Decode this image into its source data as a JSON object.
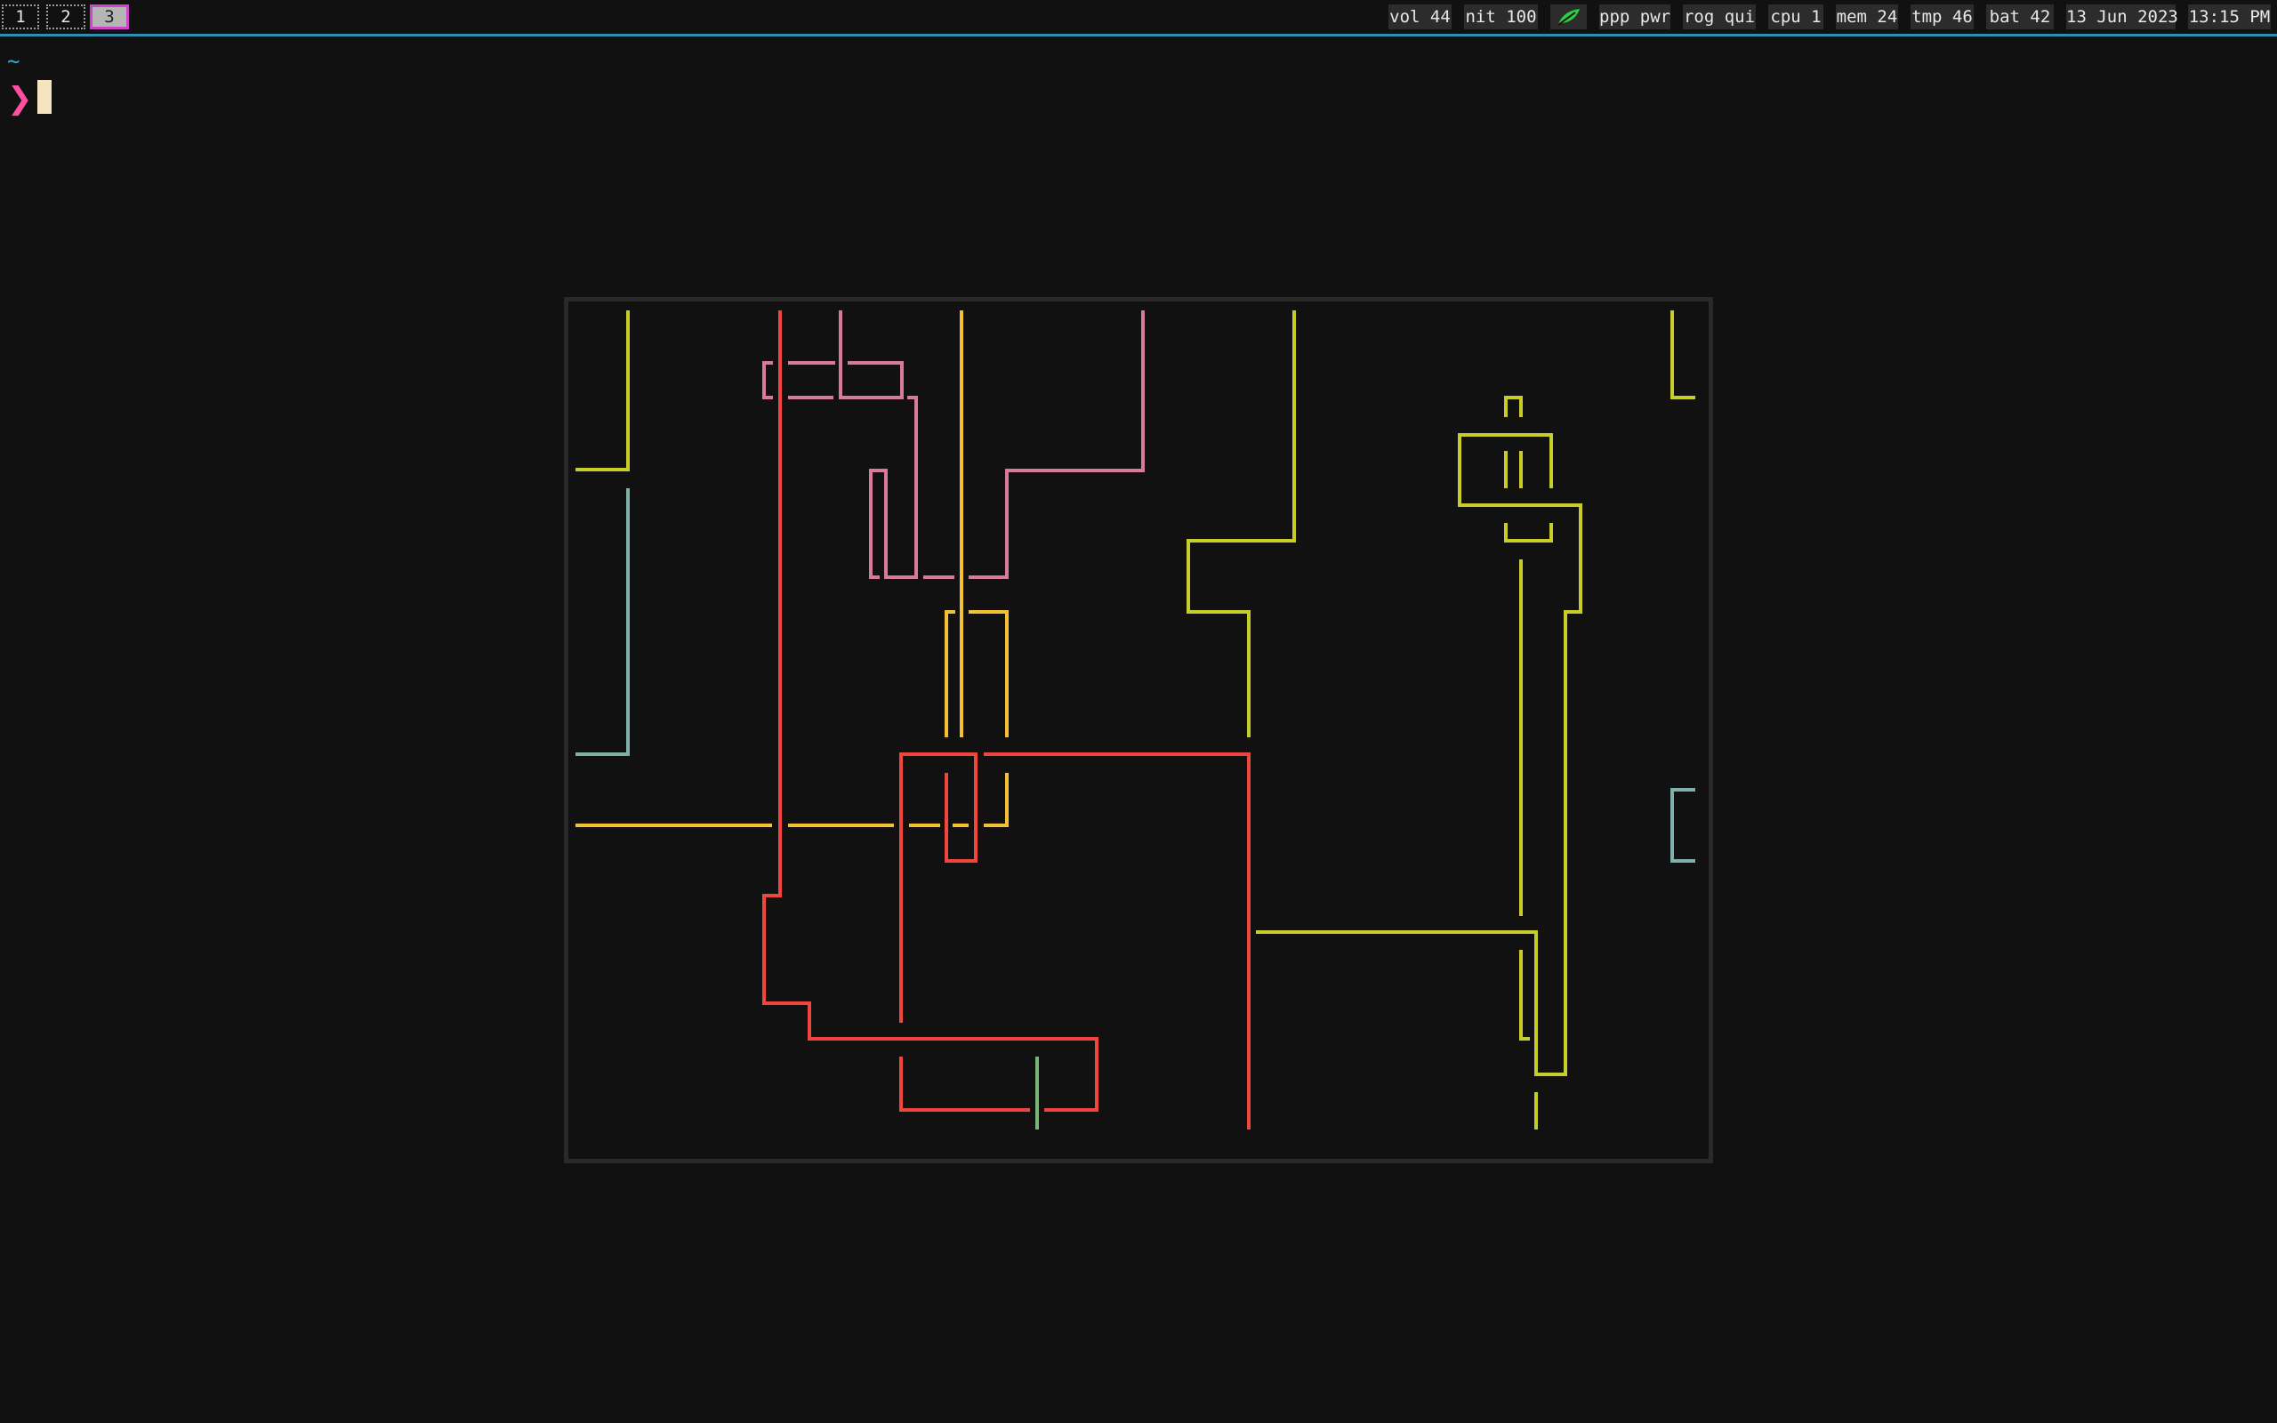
{
  "workspaces": [
    {
      "label": "1",
      "active": false
    },
    {
      "label": "2",
      "active": false
    },
    {
      "label": "3",
      "active": true
    }
  ],
  "status": {
    "vol": "vol 44",
    "nit": "nit 100",
    "ppp": "ppp pwr",
    "rog": "rog qui",
    "cpu": "cpu 1",
    "mem": "mem 24",
    "tmp": "tmp 46",
    "bat": "bat 42",
    "date": "13 Jun 2023",
    "time": "13:15 PM",
    "leaf_icon": "leaf-icon",
    "leaf_color": "#2ecc40"
  },
  "terminal": {
    "cwd": "~",
    "prompt": "❯"
  },
  "colors": {
    "accent_line": "#2f8fb0",
    "active_workspace_border": "#cc44cc",
    "pipe_red": "#f0463c",
    "pipe_pink": "#d87a9a",
    "pipe_yellow": "#f5c132",
    "pipe_olive": "#c8cc28",
    "pipe_teal": "#7fb0a8",
    "pipe_green": "#78b478"
  }
}
